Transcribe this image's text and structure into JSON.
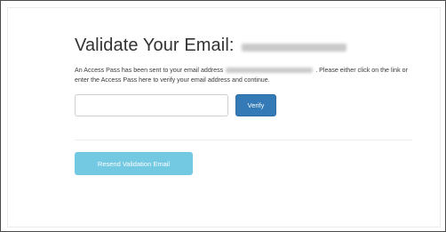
{
  "heading": {
    "title": "Validate Your Email:"
  },
  "message": {
    "before_email": "An Access Pass has been sent to your email address",
    "after_email": ". Please either click on the link or enter the Access Pass here to verify your email address and continue."
  },
  "form": {
    "access_pass_value": "",
    "verify_label": "Verify"
  },
  "actions": {
    "resend_label": "Resend Validation Email"
  },
  "colors": {
    "primary_button": "#337ab7",
    "info_button": "#5bc0de"
  }
}
